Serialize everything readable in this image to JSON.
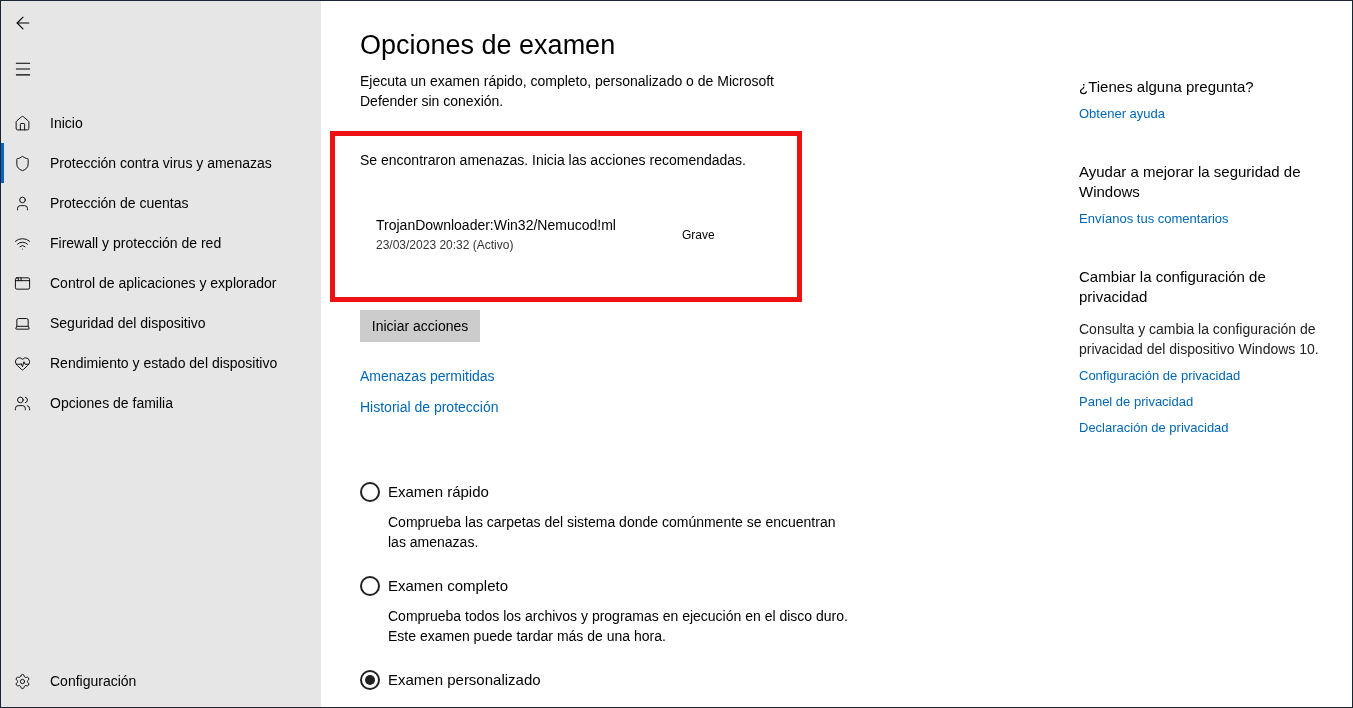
{
  "sidebar": {
    "items": [
      {
        "label": "Inicio",
        "selected": false
      },
      {
        "label": "Protección contra virus y amenazas",
        "selected": true
      },
      {
        "label": "Protección de cuentas",
        "selected": false
      },
      {
        "label": "Firewall y protección de red",
        "selected": false
      },
      {
        "label": "Control de aplicaciones y explorador",
        "selected": false
      },
      {
        "label": "Seguridad del dispositivo",
        "selected": false
      },
      {
        "label": "Rendimiento y estado del dispositivo",
        "selected": false
      },
      {
        "label": "Opciones de familia",
        "selected": false
      }
    ],
    "settings": "Configuración"
  },
  "main": {
    "title": "Opciones de examen",
    "description": "Ejecuta un examen rápido, completo, personalizado o de Microsoft Defender sin conexión.",
    "threats": {
      "message": "Se encontraron amenazas. Inicia las acciones recomendadas.",
      "items": [
        {
          "name": "TrojanDownloader:Win32/Nemucod!ml",
          "detail": "23/03/2023 20:32 (Activo)",
          "severity": "Grave"
        }
      ]
    },
    "action_button": "Iniciar acciones",
    "links": [
      "Amenazas permitidas",
      "Historial de protección"
    ],
    "scan_options": [
      {
        "label": "Examen rápido",
        "description": "Comprueba las carpetas del sistema donde comúnmente se encuentran las amenazas.",
        "selected": false
      },
      {
        "label": "Examen completo",
        "description": "Comprueba todos los archivos y programas en ejecución en el disco duro. Este examen puede tardar más de una hora.",
        "selected": false
      },
      {
        "label": "Examen personalizado",
        "selected": true
      }
    ]
  },
  "aside": [
    {
      "heading": "¿Tienes alguna pregunta?",
      "links": [
        "Obtener ayuda"
      ]
    },
    {
      "heading": "Ayudar a mejorar la seguridad de Windows",
      "links": [
        "Envíanos tus comentarios"
      ]
    },
    {
      "heading": "Cambiar la configuración de privacidad",
      "text": "Consulta y cambia la configuración de privacidad del dispositivo Windows 10.",
      "links": [
        "Configuración de privacidad",
        "Panel de privacidad",
        "Declaración de privacidad"
      ]
    }
  ]
}
